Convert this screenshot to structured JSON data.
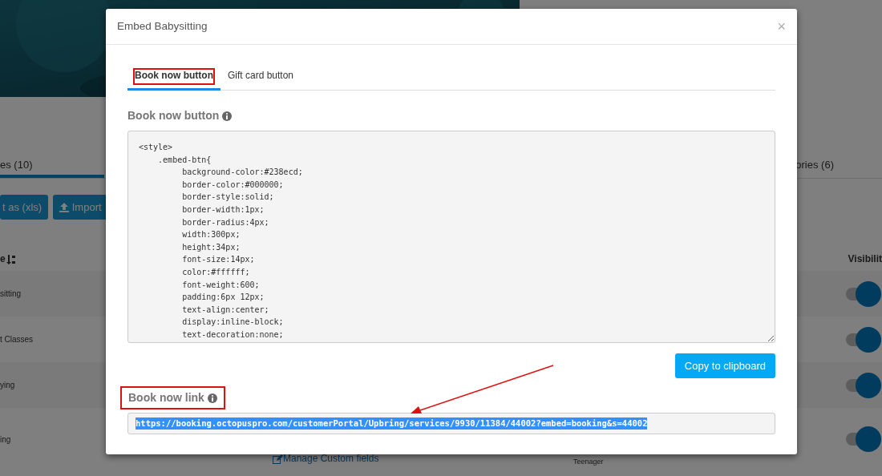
{
  "background_page": {
    "tabs": [
      {
        "label": "es (10)",
        "selected": true
      },
      {
        "label": "ories (6)",
        "selected": false
      }
    ],
    "toolbar_buttons": [
      {
        "label": "t as (xls)",
        "kind": "plain"
      },
      {
        "label": "Import",
        "kind": "upload"
      }
    ],
    "table": {
      "columns": [
        {
          "label": "e",
          "sortable": true
        },
        {
          "label": "Visibilit",
          "sortable": false
        }
      ],
      "rows": [
        {
          "column_1": "sitting",
          "visible": true
        },
        {
          "column_1": "t Classes",
          "visible": true
        },
        {
          "column_1": "ying",
          "visible": true
        },
        {
          "column_1": "ing",
          "link": "Manage Custom fields",
          "column_3": "Teenager",
          "visible": true
        }
      ]
    }
  },
  "modal": {
    "title": "Embed Babysitting",
    "close": "×",
    "tabs": [
      {
        "label": "Book now button",
        "selected": true,
        "highlighted": true
      },
      {
        "label": "Gift card button",
        "selected": false,
        "highlighted": false
      }
    ],
    "code_section": {
      "heading": "Book now button",
      "info_icon": true,
      "code_lines": [
        "<style>",
        "    .embed-btn{",
        "         background-color:#238ecd;",
        "         border-color:#000000;",
        "         border-style:solid;",
        "         border-width:1px;",
        "         border-radius:4px;",
        "         width:300px;",
        "         height:34px;",
        "         font-size:14px;",
        "         color:#ffffff;",
        "         font-weight:600;",
        "         padding:6px 12px;",
        "         text-align:center;",
        "         display:inline-block;",
        "         text-decoration:none;"
      ],
      "button": "Copy to clipboard"
    },
    "link_section": {
      "heading": "Book now link",
      "info_icon": true,
      "highlighted": true,
      "value": "https://booking.octopuspro.com/customerPortal/Upbring/services/9930/11384/44002?embed=booking&s=44002",
      "selected": true
    }
  },
  "annotation_arrow": true
}
